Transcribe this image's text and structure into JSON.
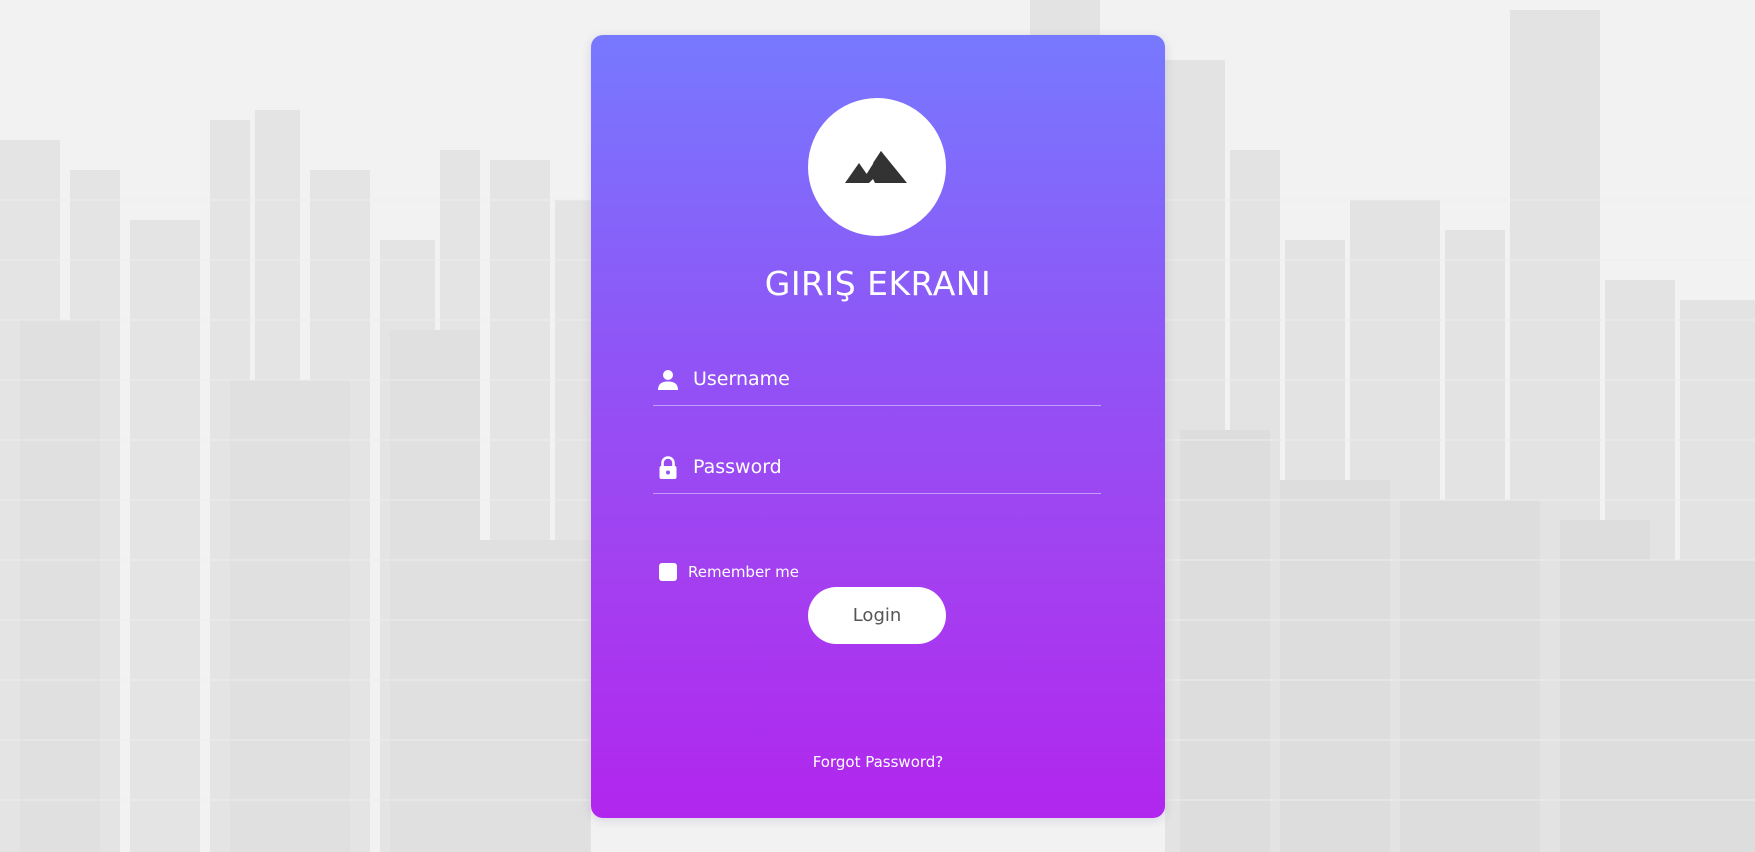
{
  "login_form": {
    "title": "GIRIŞ EKRANI",
    "logo_icon": "mountain-icon",
    "username": {
      "placeholder": "Username",
      "value": "",
      "icon": "user-icon"
    },
    "password": {
      "placeholder": "Password",
      "value": "",
      "icon": "lock-icon"
    },
    "remember_me": {
      "label": "Remember me",
      "checked": false
    },
    "login_button_label": "Login",
    "forgot_password_label": "Forgot Password?"
  },
  "colors": {
    "card_gradient_top": "#7779ff",
    "card_gradient_bottom": "#b126ee",
    "text": "#ffffff",
    "button_text": "#555555",
    "icon_dark": "#333333"
  }
}
